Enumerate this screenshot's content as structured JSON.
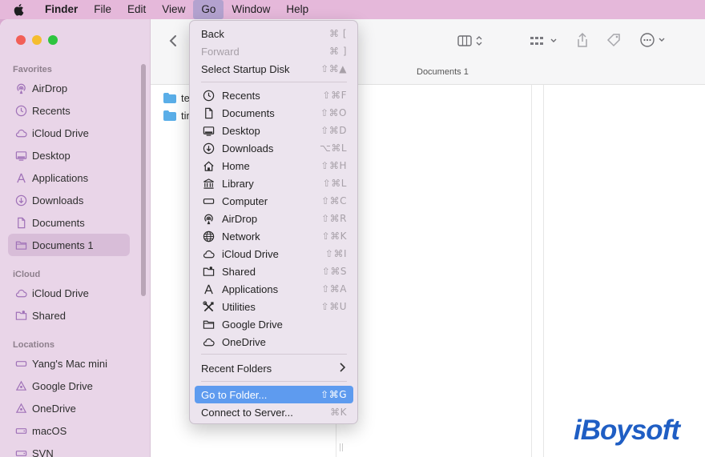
{
  "menubar": {
    "items": [
      "Finder",
      "File",
      "Edit",
      "View",
      "Go",
      "Window",
      "Help"
    ]
  },
  "sidebar": {
    "favorites_header": "Favorites",
    "favorites": [
      {
        "label": "AirDrop",
        "icon": "airdrop-icon"
      },
      {
        "label": "Recents",
        "icon": "clock-icon"
      },
      {
        "label": "iCloud Drive",
        "icon": "cloud-icon"
      },
      {
        "label": "Desktop",
        "icon": "desktop-icon"
      },
      {
        "label": "Applications",
        "icon": "applications-icon"
      },
      {
        "label": "Downloads",
        "icon": "download-icon"
      },
      {
        "label": "Documents",
        "icon": "document-icon"
      },
      {
        "label": "Documents 1",
        "icon": "folder-icon",
        "selected": true
      }
    ],
    "icloud_header": "iCloud",
    "icloud": [
      {
        "label": "iCloud Drive",
        "icon": "cloud-icon"
      },
      {
        "label": "Shared",
        "icon": "shared-folder-icon"
      }
    ],
    "locations_header": "Locations",
    "locations": [
      {
        "label": "Yang's Mac mini",
        "icon": "computer-icon"
      },
      {
        "label": "Google Drive",
        "icon": "drive-icon"
      },
      {
        "label": "OneDrive",
        "icon": "drive-icon"
      },
      {
        "label": "macOS",
        "icon": "disk-icon"
      },
      {
        "label": "SVN",
        "icon": "disk-icon"
      }
    ]
  },
  "toolbar": {
    "path_title": "Documents 1"
  },
  "files": [
    {
      "label": "te"
    },
    {
      "label": "tir"
    }
  ],
  "go_menu": {
    "top": [
      {
        "label": "Back",
        "shortcut": "⌘ [",
        "disabled": false
      },
      {
        "label": "Forward",
        "shortcut": "⌘ ]",
        "disabled": true
      },
      {
        "label": "Select Startup Disk",
        "shortcut": "⇧⌘▲",
        "disabled": false
      }
    ],
    "places": [
      {
        "label": "Recents",
        "shortcut": "⇧⌘F",
        "icon": "clock-icon"
      },
      {
        "label": "Documents",
        "shortcut": "⇧⌘O",
        "icon": "document-icon"
      },
      {
        "label": "Desktop",
        "shortcut": "⇧⌘D",
        "icon": "desktop-icon"
      },
      {
        "label": "Downloads",
        "shortcut": "⌥⌘L",
        "icon": "download-icon"
      },
      {
        "label": "Home",
        "shortcut": "⇧⌘H",
        "icon": "home-icon"
      },
      {
        "label": "Library",
        "shortcut": "⇧⌘L",
        "icon": "library-icon"
      },
      {
        "label": "Computer",
        "shortcut": "⇧⌘C",
        "icon": "computer-icon"
      },
      {
        "label": "AirDrop",
        "shortcut": "⇧⌘R",
        "icon": "airdrop-icon"
      },
      {
        "label": "Network",
        "shortcut": "⇧⌘K",
        "icon": "network-icon"
      },
      {
        "label": "iCloud Drive",
        "shortcut": "⇧⌘I",
        "icon": "cloud-icon"
      },
      {
        "label": "Shared",
        "shortcut": "⇧⌘S",
        "icon": "shared-folder-icon"
      },
      {
        "label": "Applications",
        "shortcut": "⇧⌘A",
        "icon": "applications-icon"
      },
      {
        "label": "Utilities",
        "shortcut": "⇧⌘U",
        "icon": "utilities-icon"
      },
      {
        "label": "Google Drive",
        "shortcut": "",
        "icon": "folder-icon"
      },
      {
        "label": "OneDrive",
        "shortcut": "",
        "icon": "cloud-icon"
      }
    ],
    "recent_folders": "Recent Folders",
    "go_to_folder": {
      "label": "Go to Folder...",
      "shortcut": "⇧⌘G"
    },
    "connect_to_server": {
      "label": "Connect to Server...",
      "shortcut": "⌘K"
    }
  },
  "watermark": "iBoysoft",
  "colors": {
    "menubar_bg": "#e5b8da",
    "sidebar_bg": "#e9d5e8",
    "menu_bg": "#ece4ee",
    "highlight": "#5e9bef",
    "folder_blue": "#5aaee8",
    "watermark": "#1f5ec4"
  }
}
